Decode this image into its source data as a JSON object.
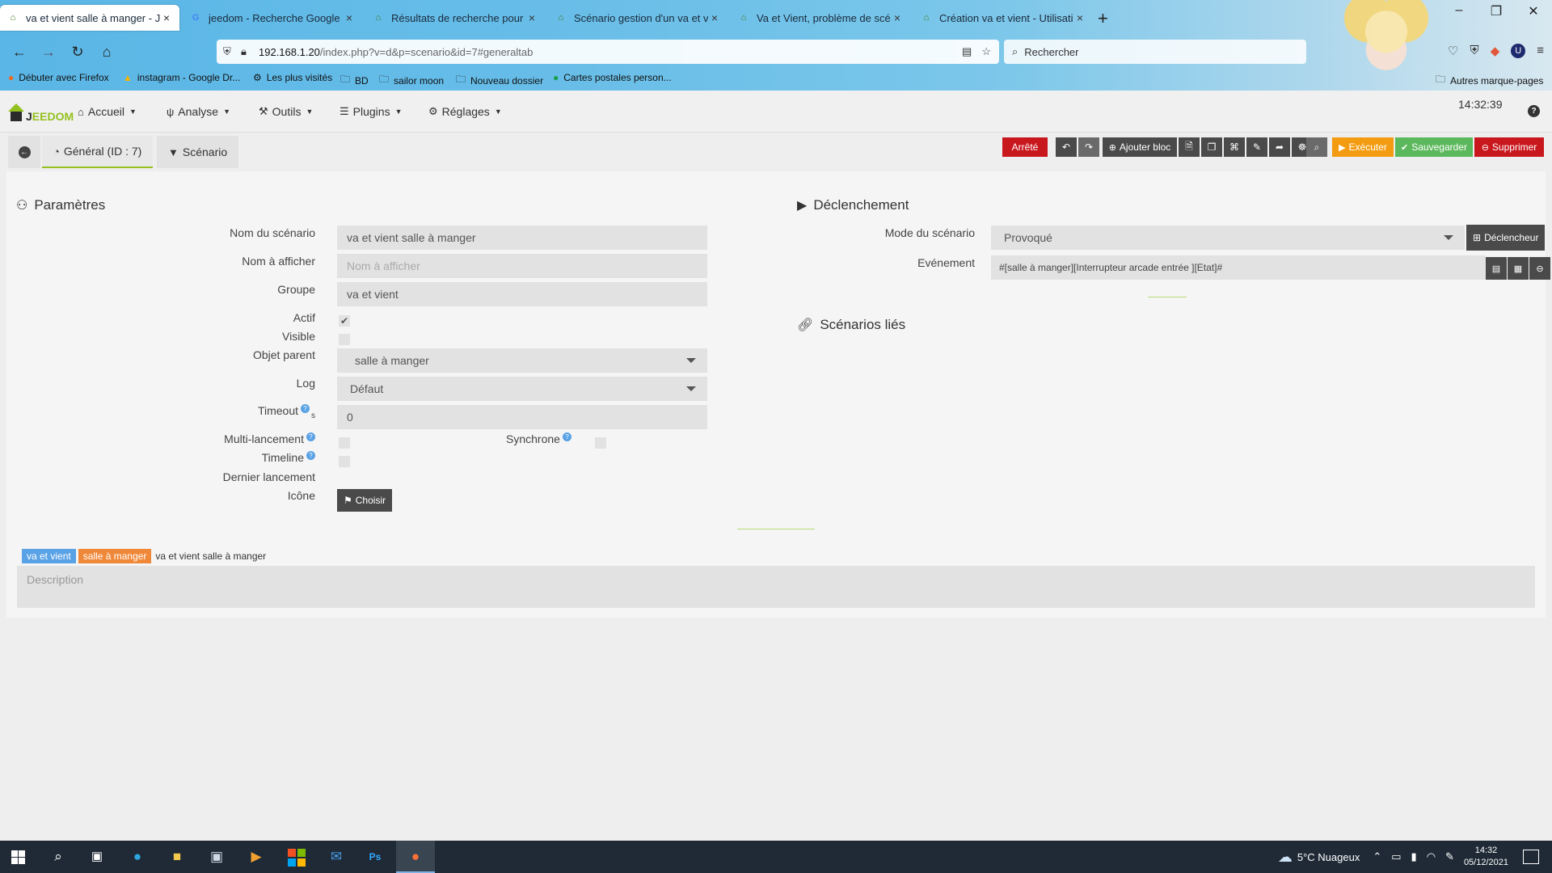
{
  "browser": {
    "tabs": [
      {
        "title": "va et vient salle à manger - Jeed",
        "active": true,
        "icon": "jeedom-favicon"
      },
      {
        "title": "jeedom - Recherche Google",
        "active": false,
        "icon": "google-favicon"
      },
      {
        "title": "Résultats de recherche pour « v",
        "active": false,
        "icon": "jeedom-favicon"
      },
      {
        "title": "Scénario gestion d'un va et vien",
        "active": false,
        "icon": "jeedom-favicon"
      },
      {
        "title": "Va et Vient, problème de scéna",
        "active": false,
        "icon": "jeedom-favicon"
      },
      {
        "title": "Création va et vient - Utilisation",
        "active": false,
        "icon": "jeedom-favicon"
      }
    ],
    "close_glyph": "×",
    "new_tab_glyph": "+",
    "url_host": "192.168.1.20",
    "url_path": "/index.php?v=d&p=scenario&id=7#generaltab",
    "search_placeholder": "Rechercher",
    "bookmarks": [
      {
        "label": "Débuter avec Firefox",
        "icon": "firefox-icon"
      },
      {
        "label": "instagram - Google Dr...",
        "icon": "google-drive-icon"
      },
      {
        "label": "Les plus visités",
        "icon": "gear-icon"
      },
      {
        "label": "BD",
        "icon": "folder-icon"
      },
      {
        "label": "sailor moon",
        "icon": "folder-icon"
      },
      {
        "label": "Nouveau dossier",
        "icon": "folder-icon"
      },
      {
        "label": "Cartes postales person...",
        "icon": "drop-icon"
      }
    ],
    "other_bookmarks": "Autres marque-pages"
  },
  "jeedom": {
    "logo_text_a": "J",
    "logo_text_b": "EEDOM",
    "menu": [
      {
        "label": "Accueil",
        "icon": "home-icon"
      },
      {
        "label": "Analyse",
        "icon": "stethoscope-icon"
      },
      {
        "label": "Outils",
        "icon": "wrench-icon"
      },
      {
        "label": "Plugins",
        "icon": "list-icon"
      },
      {
        "label": "Réglages",
        "icon": "gear-icon"
      }
    ],
    "clock": "14:32:39",
    "help_glyph": "?"
  },
  "tabs": {
    "general": "Général (ID : 7)",
    "scenario": "Scénario"
  },
  "toolbar": {
    "status": "Arrêté",
    "add_block": "Ajouter bloc",
    "execute": "Exécuter",
    "save": "Sauvegarder",
    "delete": "Supprimer",
    "colors": {
      "red": "#c9171e",
      "orange": "#f39c12",
      "green": "#5cb85c",
      "dark": "#4a4a4a"
    }
  },
  "params": {
    "title": "Paramètres",
    "labels": {
      "name": "Nom du scénario",
      "display_name": "Nom à afficher",
      "group": "Groupe",
      "active": "Actif",
      "visible": "Visible",
      "parent": "Objet parent",
      "log": "Log",
      "timeout": "Timeout",
      "timeout_unit": "s",
      "multi": "Multi-lancement",
      "sync": "Synchrone",
      "timeline": "Timeline",
      "last_run": "Dernier lancement",
      "icon": "Icône"
    },
    "values": {
      "name": "va et vient salle à manger",
      "display_name_placeholder": "Nom à afficher",
      "group": "va et vient",
      "active": true,
      "visible": false,
      "parent": "salle à manger",
      "log": "Défaut",
      "timeout": "0",
      "multi": false,
      "sync": false,
      "timeline": false,
      "last_run": ""
    },
    "choose_button": "Choisir"
  },
  "trigger": {
    "title": "Déclenchement",
    "mode_label": "Mode du scénario",
    "mode_value": "Provoqué",
    "trigger_button": "Déclencheur",
    "event_label": "Evénement",
    "event_value": "#[salle à manger][Interrupteur arcade entrée ][Etat]#"
  },
  "linked": {
    "title": "Scénarios liés"
  },
  "footer": {
    "tag_group": "va et vient",
    "tag_object": "salle à manger",
    "tag_name": "va et vient salle à manger",
    "description_placeholder": "Description"
  },
  "taskbar": {
    "weather": "5°C  Nuageux",
    "time": "14:32",
    "date": "05/12/2021"
  }
}
